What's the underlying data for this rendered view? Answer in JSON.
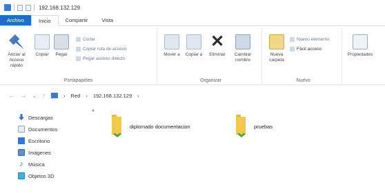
{
  "window": {
    "title": "192.168.132.129"
  },
  "ribbon_tabs": [
    {
      "label": "Archivo"
    },
    {
      "label": "Inicio"
    },
    {
      "label": "Compartir"
    },
    {
      "label": "Vista"
    }
  ],
  "ribbon": {
    "portapapeles": {
      "label": "Portapapeles",
      "pin_label": "Anclar al Acceso rápido",
      "copy_label": "Copiar",
      "paste_label": "Pegar",
      "cut_label": "Cortar",
      "copy_path_label": "Copiar ruta de acceso",
      "paste_shortcut_label": "Pegar acceso directo"
    },
    "organizar": {
      "label": "Organizar",
      "move_label": "Mover a",
      "copy_to_label": "Copiar a",
      "delete_label": "Eliminar",
      "rename_label": "Cambiar nombre"
    },
    "nuevo": {
      "label": "Nuevo",
      "new_folder_label": "Nueva carpeta",
      "new_item_label": "Nuevo elemento",
      "easy_access_label": "Fácil acceso"
    },
    "abrir": {
      "properties_label": "Propiedades"
    }
  },
  "address": {
    "back": "←",
    "forward": "→",
    "recent": "⌄",
    "up": "↑",
    "crumbs": [
      "Red",
      "192.168.132.129"
    ],
    "separator": "›"
  },
  "nav_pane": {
    "items": [
      {
        "label": "Descargas",
        "icon": "download-icon"
      },
      {
        "label": "Documentos",
        "icon": "documents-icon"
      },
      {
        "label": "Escritorio",
        "icon": "desktop-icon"
      },
      {
        "label": "Imágenes",
        "icon": "pictures-icon"
      },
      {
        "label": "Música",
        "icon": "music-icon"
      },
      {
        "label": "Objetos 3D",
        "icon": "3d-objects-icon"
      }
    ]
  },
  "content": {
    "folders": [
      {
        "name": "diplomado documentacion"
      },
      {
        "name": "pruebas"
      }
    ]
  },
  "colors": {
    "file_tab": "#1f6fc9",
    "folder": "#f2c94c"
  }
}
